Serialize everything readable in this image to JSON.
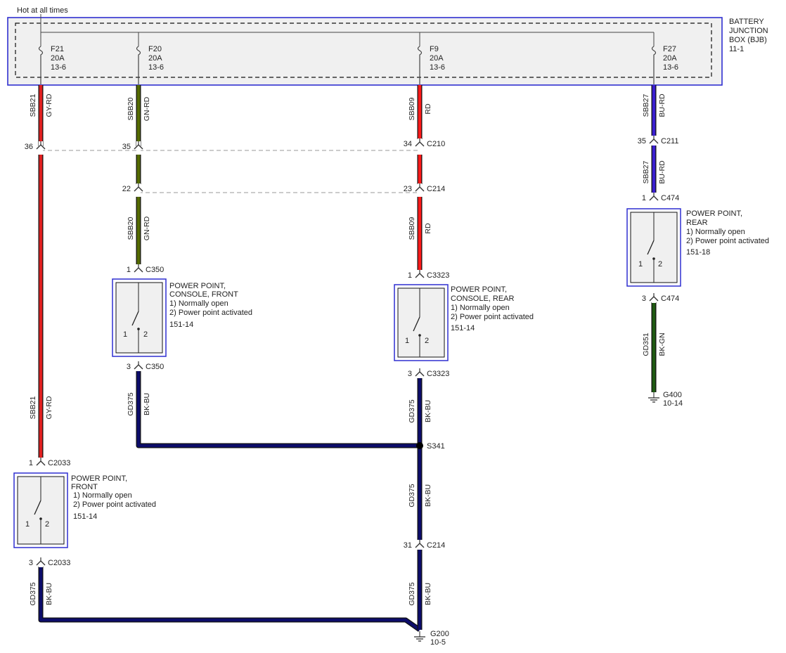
{
  "header": {
    "hot_label": "Hot at all times"
  },
  "bjb": {
    "title": [
      "BATTERY",
      "JUNCTION",
      "BOX (BJB)"
    ],
    "ref": "11-1"
  },
  "colors": {
    "GY-RD": "#e02020",
    "GN-RD": "#556b00",
    "RD": "#ff1a1a",
    "BU-RD": "#3a1fd0",
    "BK-BU": "#0c0c6a",
    "BK-GN": "#1f5a12",
    "outline_blue": "#2f2fd0",
    "box_fill": "#f0f0f0",
    "connector": "#444444",
    "dashed": "#9a9a9a"
  },
  "fuses": [
    {
      "id": "f21",
      "name": "F21",
      "rating": "20A",
      "ref": "13-6"
    },
    {
      "id": "f20",
      "name": "F20",
      "rating": "20A",
      "ref": "13-6"
    },
    {
      "id": "f9",
      "name": "F9",
      "rating": "20A",
      "ref": "13-6"
    },
    {
      "id": "f27",
      "name": "F27",
      "rating": "20A",
      "ref": "13-6"
    }
  ],
  "wires": [
    {
      "id": "w-f21-a",
      "circuit": "SBB21",
      "color": "GY-RD"
    },
    {
      "id": "w-f21-b",
      "circuit": "SBB21",
      "color": "GY-RD"
    },
    {
      "id": "w-f21-c",
      "circuit": "GD375",
      "color": "BK-BU"
    },
    {
      "id": "w-f20-a",
      "circuit": "SBB20",
      "color": "GN-RD"
    },
    {
      "id": "w-f20-b",
      "circuit": "SBB20",
      "color": "GN-RD"
    },
    {
      "id": "w-f20-c",
      "circuit": "GD375",
      "color": "BK-BU"
    },
    {
      "id": "w-f9-a",
      "circuit": "SBB09",
      "color": "RD"
    },
    {
      "id": "w-f9-b",
      "circuit": "SBB09",
      "color": "RD"
    },
    {
      "id": "w-f9-c",
      "circuit": "GD375",
      "color": "BK-BU"
    },
    {
      "id": "w-f9-d",
      "circuit": "GD375",
      "color": "BK-BU"
    },
    {
      "id": "w-f9-e",
      "circuit": "GD375",
      "color": "BK-BU"
    },
    {
      "id": "w-f27-a",
      "circuit": "SBB27",
      "color": "BU-RD"
    },
    {
      "id": "w-f27-b",
      "circuit": "SBB27",
      "color": "BU-RD"
    },
    {
      "id": "w-f27-c",
      "circuit": "GD351",
      "color": "BK-GN"
    }
  ],
  "connectors": [
    {
      "id": "c2033-1",
      "pin": "1",
      "name": "C2033"
    },
    {
      "id": "c2033-3",
      "pin": "3",
      "name": "C2033"
    },
    {
      "id": "c21-36",
      "pin": "36",
      "name": ""
    },
    {
      "id": "c20-35",
      "pin": "35",
      "name": ""
    },
    {
      "id": "c20-22",
      "pin": "22",
      "name": ""
    },
    {
      "id": "c350-1",
      "pin": "1",
      "name": "C350"
    },
    {
      "id": "c350-3",
      "pin": "3",
      "name": "C350"
    },
    {
      "id": "c210-34",
      "pin": "34",
      "name": "C210"
    },
    {
      "id": "c214-23",
      "pin": "23",
      "name": "C214"
    },
    {
      "id": "c3323-1",
      "pin": "1",
      "name": "C3323"
    },
    {
      "id": "c3323-3",
      "pin": "3",
      "name": "C3323"
    },
    {
      "id": "c214-31",
      "pin": "31",
      "name": "C214"
    },
    {
      "id": "c211-35",
      "pin": "35",
      "name": "C211"
    },
    {
      "id": "c474-1",
      "pin": "1",
      "name": "C474"
    },
    {
      "id": "c474-3",
      "pin": "3",
      "name": "C474"
    }
  ],
  "components": [
    {
      "id": "pp-front",
      "lines": [
        "POWER POINT,",
        "FRONT"
      ],
      "notes": [
        "1) Normally open",
        "2) Power point activated"
      ],
      "ref": "151-14",
      "pin_a": "1",
      "pin_b": "2"
    },
    {
      "id": "pp-cfront",
      "lines": [
        "POWER POINT,",
        "CONSOLE, FRONT"
      ],
      "notes": [
        "1) Normally open",
        "2) Power point activated"
      ],
      "ref": "151-14",
      "pin_a": "1",
      "pin_b": "2"
    },
    {
      "id": "pp-crear",
      "lines": [
        "POWER POINT,",
        "CONSOLE, REAR"
      ],
      "notes": [
        "1) Normally open",
        "2) Power point activated"
      ],
      "ref": "151-14",
      "pin_a": "1",
      "pin_b": "2"
    },
    {
      "id": "pp-rear",
      "lines": [
        "POWER POINT,",
        "REAR"
      ],
      "notes": [
        "1) Normally open",
        "2) Power point activated"
      ],
      "ref": "151-18",
      "pin_a": "1",
      "pin_b": "2"
    }
  ],
  "splice": {
    "name": "S341"
  },
  "grounds": [
    {
      "id": "g200",
      "name": "G200",
      "ref": "10-5"
    },
    {
      "id": "g400",
      "name": "G400",
      "ref": "10-14"
    }
  ]
}
